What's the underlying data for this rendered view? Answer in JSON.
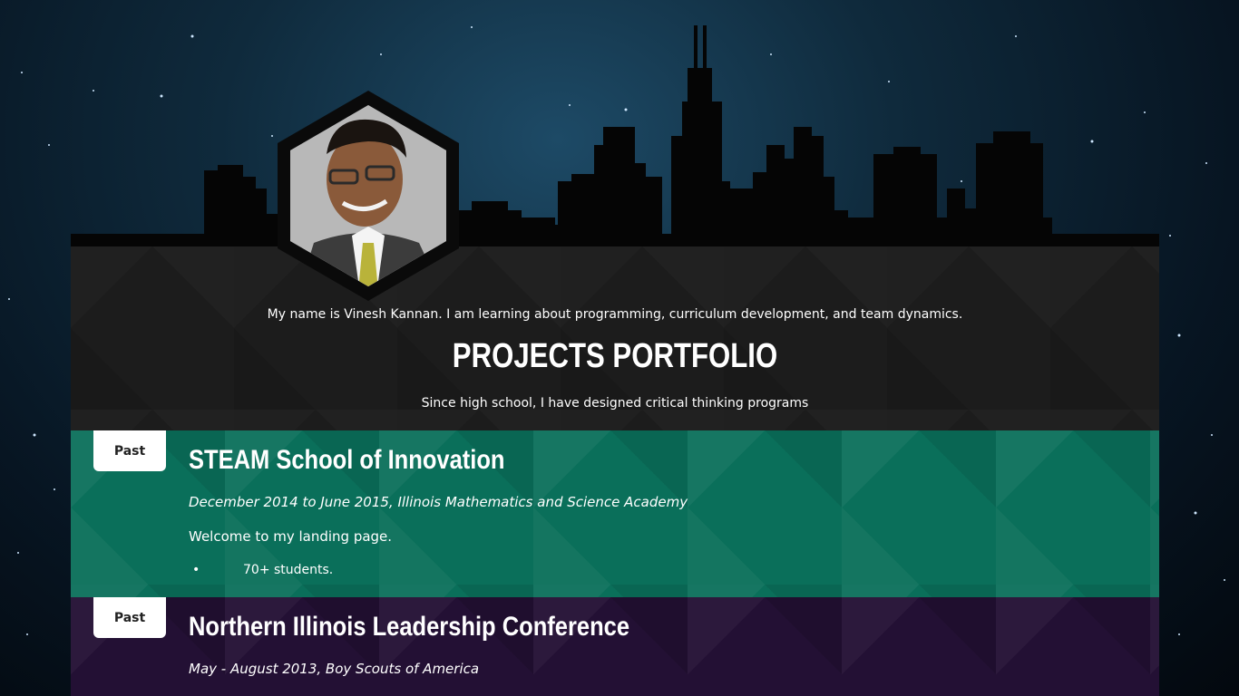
{
  "profile": {
    "tagline": "My name is Vinesh Kannan. I am learning about programming, curriculum development, and team dynamics.",
    "title": "PROJECTS PORTFOLIO",
    "subtitle": "Since high school, I have designed critical thinking programs"
  },
  "projects": [
    {
      "badge": "Past",
      "title": "STEAM School of Innovation",
      "meta": "December 2014 to June 2015, Illinois Mathematics and Science Academy",
      "description": "Welcome to my landing page.",
      "bullets": [
        "70+ students."
      ],
      "color": "#0a6f5a"
    },
    {
      "badge": "Past",
      "title": "Northern Illinois Leadership Conference",
      "meta": "May - August 2013, Boy Scouts of America",
      "color": "#231034"
    }
  ],
  "colors": {
    "header_panel": "#1c1c1c",
    "badge_bg": "#ffffff",
    "text": "#ffffff"
  },
  "icons": {
    "avatar": "profile-photo-hexagon"
  }
}
